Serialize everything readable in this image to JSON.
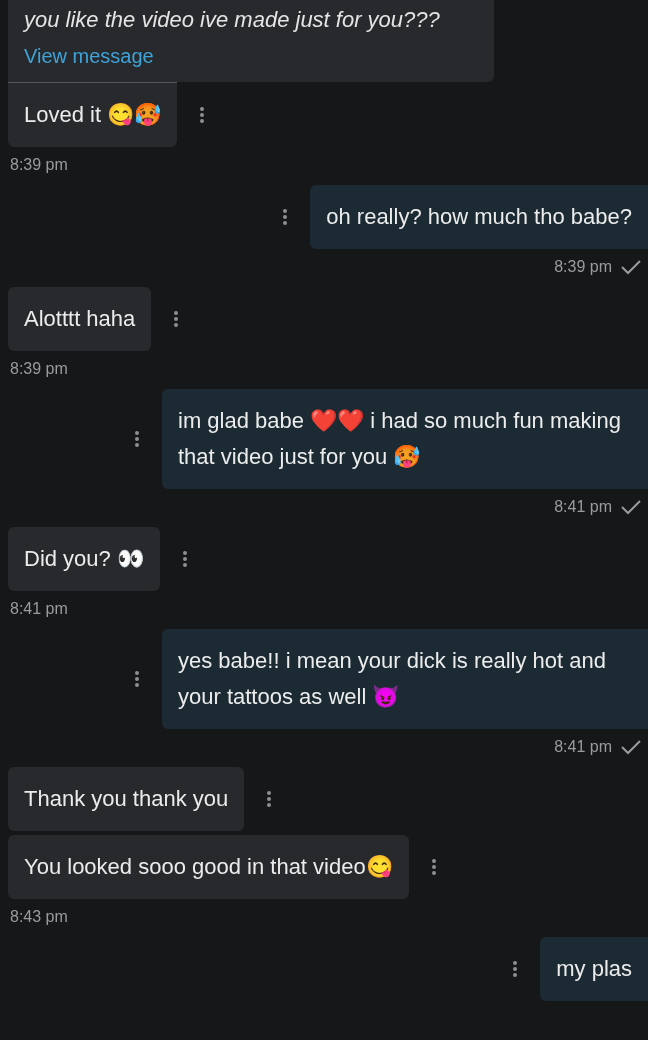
{
  "messages": [
    {
      "kind": "incoming",
      "quote": {
        "text": "you like the video ive made just for you???",
        "link": "View message"
      },
      "bubbles": [
        "Loved it 😋🥵"
      ],
      "time": "8:39 pm"
    },
    {
      "kind": "outgoing",
      "bubbles": [
        "oh really? how much tho babe?"
      ],
      "time": "8:39 pm",
      "delivered": true
    },
    {
      "kind": "incoming",
      "bubbles": [
        "Alotttt haha"
      ],
      "time": "8:39 pm"
    },
    {
      "kind": "outgoing",
      "bubbles": [
        "im glad babe ❤️❤️ i had so much fun making that video just for you 🥵"
      ],
      "time": "8:41 pm",
      "delivered": true
    },
    {
      "kind": "incoming",
      "bubbles": [
        "Did you? 👀"
      ],
      "time": "8:41 pm"
    },
    {
      "kind": "outgoing",
      "bubbles": [
        "yes babe!! i mean your dick is really hot and your tattoos as well 😈"
      ],
      "time": "8:41 pm",
      "delivered": true
    },
    {
      "kind": "incoming",
      "bubbles": [
        "Thank you thank you",
        "You looked sooo good in that video😋"
      ],
      "time": "8:43 pm"
    },
    {
      "kind": "outgoing",
      "bubbles": [
        "my plas"
      ]
    }
  ]
}
